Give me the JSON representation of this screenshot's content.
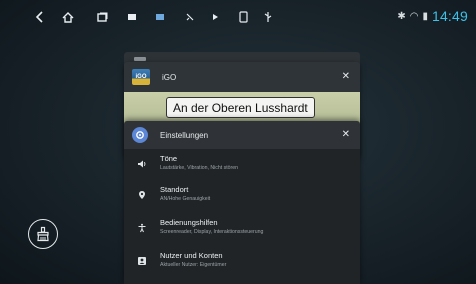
{
  "status_bar": {
    "bluetooth_glyph": "✱",
    "wifi_glyph": "◠",
    "battery_glyph": "▮",
    "time": "14:49",
    "time_color": "#3ec0e8"
  },
  "nav_icons": [
    "back-icon",
    "home-icon",
    "recents-icon",
    "media-icon",
    "gallery-icon",
    "navigation-icon",
    "play-icon",
    "phone-icon",
    "usb-icon"
  ],
  "recents": {
    "igo_card": {
      "app_name": "iGO",
      "close": "✕",
      "map_street_label": "An der Oberen Lusshardt"
    },
    "settings_card": {
      "app_name": "Einstellungen",
      "close": "✕",
      "items": [
        {
          "icon": "volume-icon",
          "title": "Töne",
          "subtitle": "Lautstärke, Vibration, Nicht stören"
        },
        {
          "icon": "location-icon",
          "title": "Standort",
          "subtitle": "AN/Hohe Genauigkeit"
        },
        {
          "icon": "accessibility-icon",
          "title": "Bedienungshilfen",
          "subtitle": "Screenreader, Display, Interaktionssteuerung"
        },
        {
          "icon": "account-icon",
          "title": "Nutzer und Konten",
          "subtitle": "Aktueller Nutzer: Eigentümer"
        }
      ]
    }
  },
  "clear_all_icon": "broom-icon"
}
